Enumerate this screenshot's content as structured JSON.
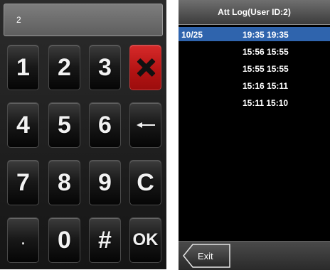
{
  "keypad": {
    "input_value": "2",
    "keys": {
      "k1": "1",
      "k2": "2",
      "k3": "3",
      "k4": "4",
      "k5": "5",
      "k6": "6",
      "k_c": "C",
      "k7": "7",
      "k8": "8",
      "k9": "9",
      "k_dot": ".",
      "k0": "0",
      "k_hash": "#",
      "k_ok": "OK"
    },
    "delete_icon": "close-x-icon",
    "backspace_icon": "backspace-arrow-icon",
    "delete_color": "#c41a1a"
  },
  "att_log": {
    "title": "Att Log(User ID:2)",
    "rows": [
      {
        "date": "10/25",
        "times": "19:35 19:35",
        "selected": true
      },
      {
        "date": "",
        "times": "15:56 15:55",
        "selected": false
      },
      {
        "date": "",
        "times": "15:55 15:55",
        "selected": false
      },
      {
        "date": "",
        "times": "15:16 15:11",
        "selected": false
      },
      {
        "date": "",
        "times": "15:11 15:10",
        "selected": false
      }
    ],
    "selected_color": "#2f64ad",
    "exit_label": "Exit"
  }
}
